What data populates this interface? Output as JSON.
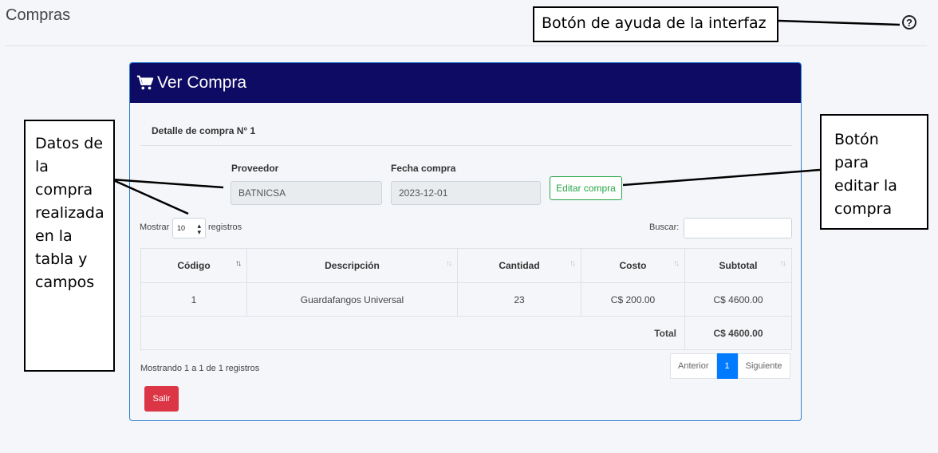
{
  "page": {
    "title": "Compras",
    "help_icon": "question-circle-icon"
  },
  "card": {
    "title": "Ver Compra",
    "header_color": "#0d0b63",
    "icon": "shopping-cart-icon",
    "detail_title": "Detalle de compra N° 1"
  },
  "form": {
    "supplier_label": "Proveedor",
    "supplier_value": "BATNICSA",
    "date_label": "Fecha compra",
    "date_value": "2023-12-01",
    "edit_button": "Editar compra"
  },
  "table_controls": {
    "show_label": "Mostrar",
    "page_length": "10",
    "records_label": "registros",
    "search_label": "Buscar:",
    "search_value": ""
  },
  "table": {
    "columns": [
      "Código",
      "Descripción",
      "Cantidad",
      "Costo",
      "Subtotal"
    ],
    "rows": [
      [
        "1",
        "Guardafangos Universal",
        "23",
        "C$ 200.00",
        "C$ 4600.00"
      ]
    ],
    "total_label": "Total",
    "total_value": "C$ 4600.00"
  },
  "footer": {
    "info": "Mostrando 1 a 1 de 1 registros",
    "prev": "Anterior",
    "page": "1",
    "next": "Siguiente",
    "exit_button": "Salir"
  },
  "annotations": {
    "help": "Botón de ayuda de la interfaz",
    "data": [
      "Datos de",
      "la",
      "compra",
      "realizada",
      "en la",
      "tabla y",
      "campos"
    ],
    "edit": [
      "Botón para",
      "editar la",
      "compra"
    ]
  },
  "colors": {
    "accent_primary": "#007bff",
    "success": "#28a745",
    "danger": "#dc3545"
  }
}
